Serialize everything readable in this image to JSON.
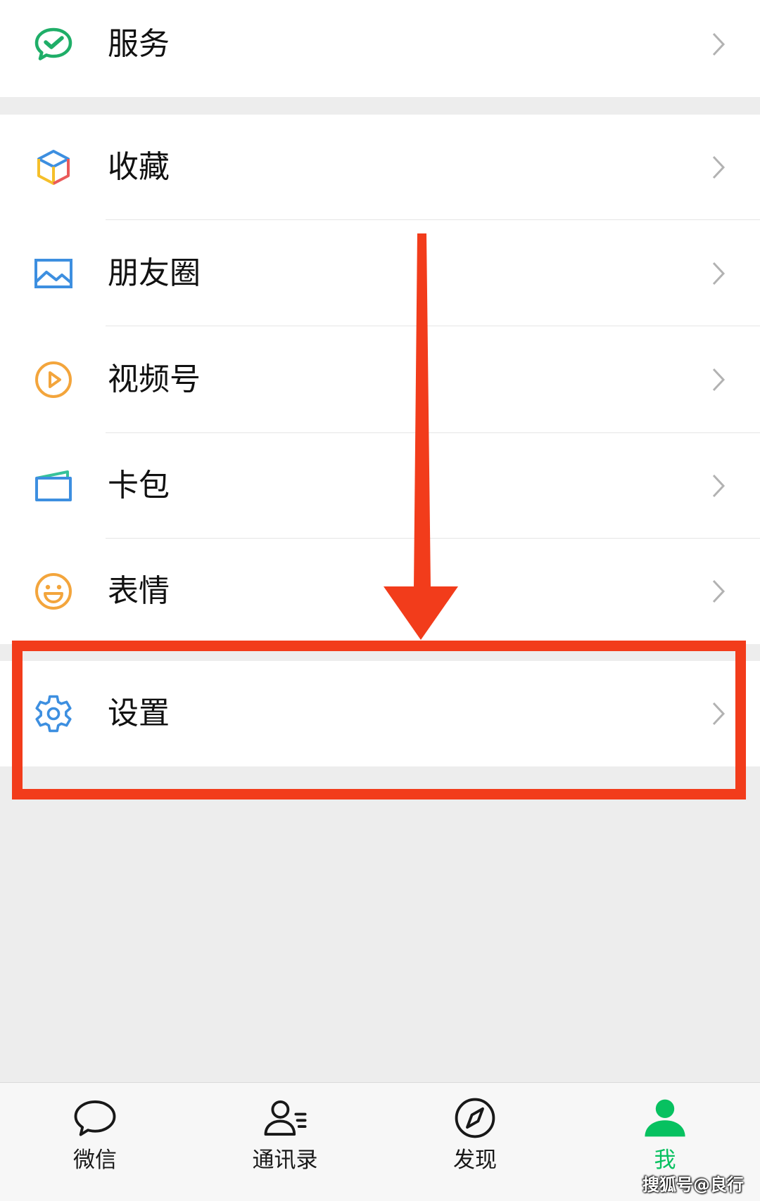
{
  "colors": {
    "page_background": "#ededed",
    "row_background": "#ffffff",
    "text": "#111111",
    "chevron": "#b2b2b2",
    "divider": "#e5e5e5",
    "accent_green": "#07c160",
    "annotation_red": "#f23c1b",
    "tab_bar_background": "#f7f7f7"
  },
  "menu": {
    "service": {
      "label": "服务",
      "icon": "service-check-bubble-icon"
    },
    "items": [
      {
        "label": "收藏",
        "icon": "favorites-cube-icon"
      },
      {
        "label": "朋友圈",
        "icon": "moments-picture-icon"
      },
      {
        "label": "视频号",
        "icon": "channels-play-icon"
      },
      {
        "label": "卡包",
        "icon": "card-wallet-icon"
      },
      {
        "label": "表情",
        "icon": "sticker-smiley-icon"
      }
    ],
    "settings": {
      "label": "设置",
      "icon": "gear-icon",
      "highlighted": true
    }
  },
  "tab_bar": {
    "tabs": [
      {
        "label": "微信",
        "icon": "chat-bubble-icon",
        "active": false
      },
      {
        "label": "通讯录",
        "icon": "contacts-icon",
        "active": false
      },
      {
        "label": "发现",
        "icon": "compass-icon",
        "active": false
      },
      {
        "label": "我",
        "icon": "person-filled-icon",
        "active": true
      }
    ]
  },
  "watermark": "搜狐号@良行"
}
